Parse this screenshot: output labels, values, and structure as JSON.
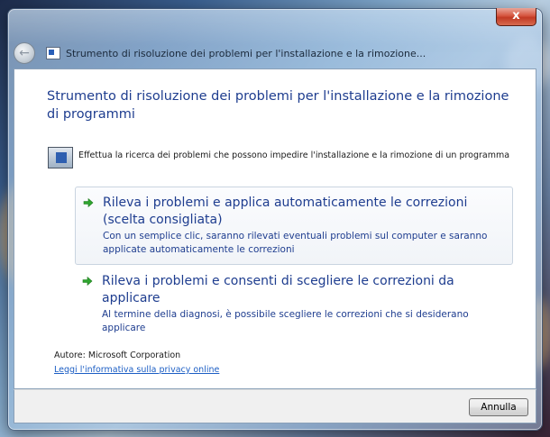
{
  "window": {
    "title": "Strumento di risoluzione dei problemi per l'installazione e la rimozione...",
    "close_glyph": "x"
  },
  "main": {
    "heading": "Strumento di risoluzione dei problemi per l'installazione e la rimozione di programmi",
    "info_text": "Effettua la ricerca dei problemi che possono impedire l'installazione e la rimozione di un programma",
    "options": [
      {
        "title": "Rileva i problemi e applica automaticamente le correzioni (scelta consigliata)",
        "description": "Con un semplice clic, saranno rilevati eventuali problemi sul computer e saranno applicate automaticamente le correzioni",
        "icon": "green-arrow-icon"
      },
      {
        "title": "Rileva i problemi e consenti di scegliere le correzioni da applicare",
        "description": "Al termine della diagnosi, è possibile scegliere le correzioni che si desiderano applicare",
        "icon": "green-arrow-icon"
      }
    ],
    "author": "Autore: Microsoft Corporation",
    "privacy_link": "Leggi l'informativa sulla privacy online"
  },
  "footer": {
    "cancel_label": "Annulla"
  },
  "colors": {
    "heading": "#1e3d8f",
    "link": "#1c5ec4",
    "arrow": "#2fa52f"
  }
}
